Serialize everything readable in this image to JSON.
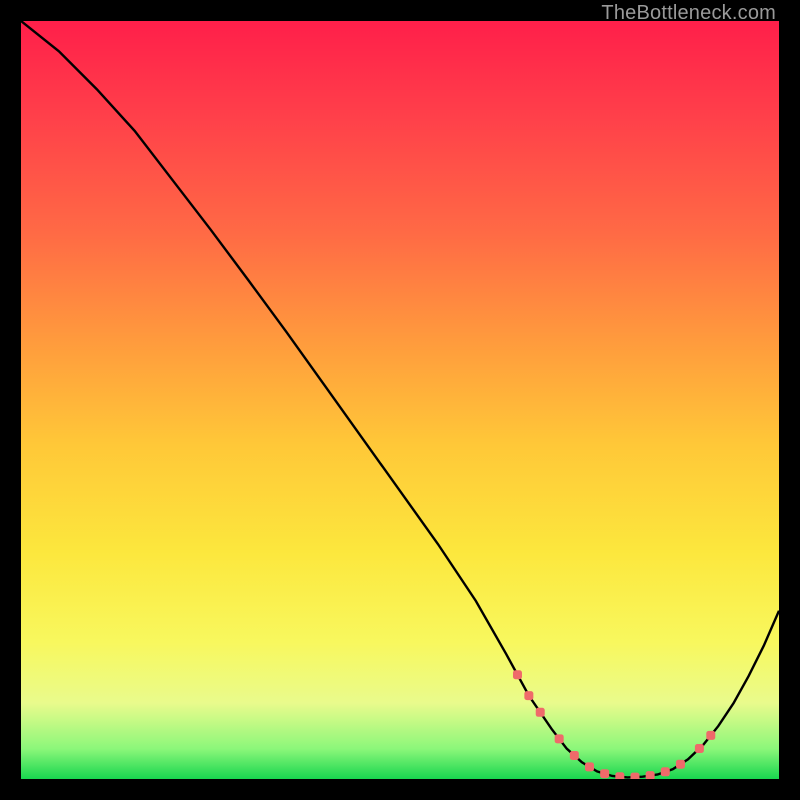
{
  "attribution": "TheBottleneck.com",
  "chart_data": {
    "type": "line",
    "title": "",
    "xlabel": "",
    "ylabel": "",
    "xlim": [
      0,
      100
    ],
    "ylim": [
      0,
      100
    ],
    "series": [
      {
        "name": "bottleneck-curve",
        "x": [
          0,
          5,
          10,
          15,
          20,
          25,
          30,
          35,
          40,
          45,
          50,
          55,
          60,
          64,
          67,
          70,
          72,
          74,
          76,
          78,
          80,
          82,
          84,
          86,
          88,
          90,
          92,
          94,
          96,
          98,
          100
        ],
        "values": [
          100,
          96,
          91,
          85.5,
          79,
          72.5,
          65.8,
          59,
          52,
          45,
          38,
          31,
          23.5,
          16.5,
          11,
          6.6,
          4.0,
          2.2,
          1.0,
          0.4,
          0.2,
          0.3,
          0.6,
          1.3,
          2.6,
          4.5,
          7.0,
          10.0,
          13.6,
          17.6,
          22.2
        ]
      }
    ],
    "flat_region": {
      "x_start": 70,
      "x_end": 88
    },
    "marker_color": "#ef6a6a",
    "line_color": "#000000",
    "gradient_stops": [
      {
        "pos": 0,
        "color": "#ff1f4a"
      },
      {
        "pos": 12,
        "color": "#ff3e4a"
      },
      {
        "pos": 28,
        "color": "#ff6a45"
      },
      {
        "pos": 42,
        "color": "#ff9a3d"
      },
      {
        "pos": 56,
        "color": "#ffc838"
      },
      {
        "pos": 70,
        "color": "#fce73d"
      },
      {
        "pos": 82,
        "color": "#f8f85e"
      },
      {
        "pos": 90,
        "color": "#e9fb8c"
      },
      {
        "pos": 96,
        "color": "#8cf77a"
      },
      {
        "pos": 100,
        "color": "#18d64f"
      }
    ]
  }
}
